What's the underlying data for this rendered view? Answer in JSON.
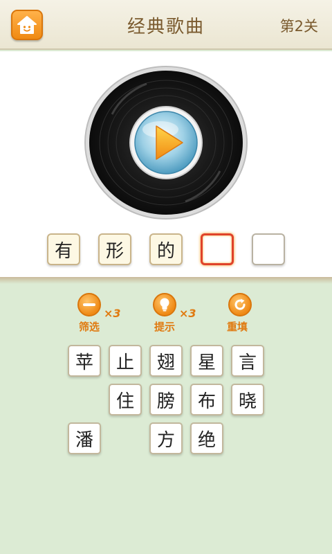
{
  "header": {
    "title": "经典歌曲",
    "level": "第2关"
  },
  "answer": [
    {
      "char": "有",
      "state": "filled"
    },
    {
      "char": "形",
      "state": "filled"
    },
    {
      "char": "的",
      "state": "filled"
    },
    {
      "char": "",
      "state": "active"
    },
    {
      "char": "",
      "state": "empty"
    }
  ],
  "tools": {
    "filter": {
      "label": "筛选",
      "count": "×3",
      "icon": "minus-icon"
    },
    "hint": {
      "label": "提示",
      "count": "×3",
      "icon": "lightbulb-icon"
    },
    "reset": {
      "label": "重填",
      "icon": "refresh-icon"
    }
  },
  "candidates": {
    "row1": [
      "苹",
      "止",
      "翅",
      "星",
      "言"
    ],
    "row2": [
      "",
      "住",
      "膀",
      "布",
      "晓"
    ],
    "row3": [
      "潘",
      "",
      "方",
      "绝",
      ""
    ]
  },
  "colors": {
    "accent": "#f08a12",
    "title": "#7a5a2e",
    "background": "#dcebd4",
    "active_slot": "#e0422a"
  }
}
